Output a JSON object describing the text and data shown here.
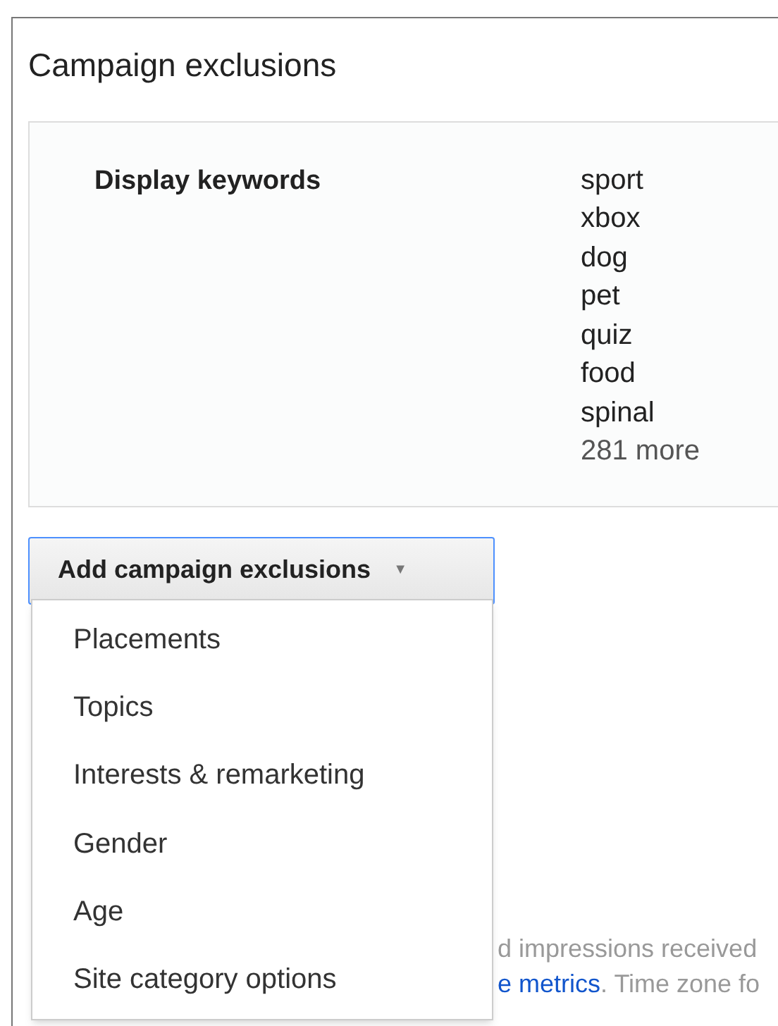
{
  "title": "Campaign exclusions",
  "exclusions": {
    "label": "Display keywords",
    "keywords": [
      "sport",
      "xbox",
      "dog",
      "pet",
      "quiz",
      "food",
      "spinal"
    ],
    "more": "281 more"
  },
  "dropdown": {
    "label": "Add campaign exclusions",
    "expanded": true,
    "caret": "▼",
    "items": [
      {
        "label": "Placements"
      },
      {
        "label": "Topics"
      },
      {
        "label": "Interests & remarketing"
      },
      {
        "label": "Gender"
      },
      {
        "label": "Age"
      },
      {
        "label": "Site category options"
      }
    ]
  },
  "footnote": {
    "line_1": "d impressions received",
    "link": "e metrics",
    "rest": ". Time zone fo"
  }
}
